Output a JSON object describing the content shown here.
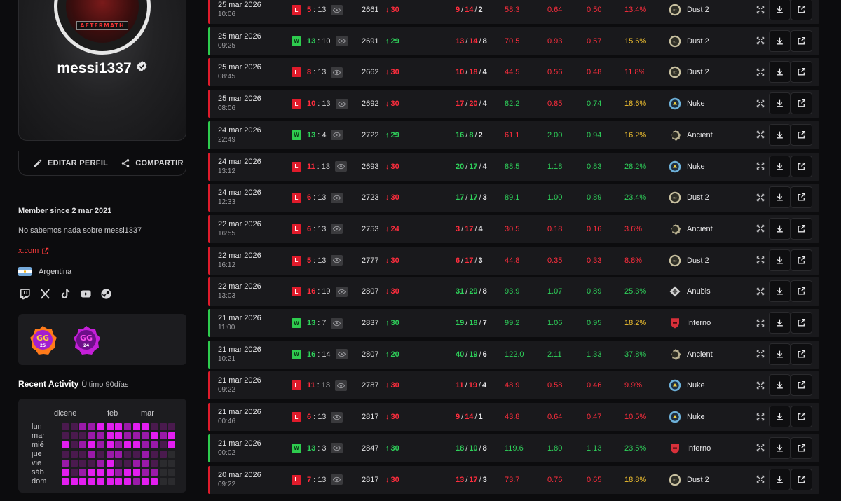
{
  "profile": {
    "username": "messi1337",
    "avatar_text": "AFTERMATH",
    "edit_label": "EDITAR PERFIL",
    "share_label": "COMPARTIR",
    "member_since": "Member since 2 mar 2021",
    "bio": "No sabemos nada sobre messi1337",
    "link": "x.com",
    "country": "Argentina",
    "socials": [
      "twitch-icon",
      "x-icon",
      "tiktok-icon",
      "youtube-icon",
      "steam-icon"
    ],
    "badges": [
      {
        "label": "GG",
        "year": "25"
      },
      {
        "label": "GG",
        "year": "24"
      }
    ]
  },
  "activity": {
    "title": "Recent Activity",
    "subtitle": "Último 90días",
    "months": [
      "dicene",
      "feb",
      "mar"
    ],
    "days": [
      "lun",
      "mar",
      "mié",
      "jue",
      "vie",
      "sáb",
      "dom"
    ],
    "levels": [
      [
        1,
        1,
        2,
        2,
        3,
        3,
        3,
        2,
        3,
        3,
        1,
        1,
        1
      ],
      [
        1,
        1,
        1,
        2,
        2,
        3,
        3,
        2,
        2,
        2,
        3,
        2,
        3
      ],
      [
        3,
        1,
        2,
        3,
        2,
        3,
        2,
        3,
        3,
        2,
        2,
        1,
        3
      ],
      [
        1,
        1,
        1,
        2,
        1,
        2,
        2,
        1,
        1,
        2,
        1,
        1,
        0
      ],
      [
        2,
        1,
        1,
        1,
        2,
        3,
        1,
        1,
        2,
        2,
        1,
        0,
        0
      ],
      [
        3,
        1,
        2,
        3,
        3,
        3,
        2,
        3,
        3,
        2,
        2,
        0,
        0
      ],
      [
        3,
        3,
        3,
        3,
        3,
        3,
        3,
        3,
        2,
        3,
        3,
        0,
        0
      ]
    ],
    "colors": [
      "#2b2b2e",
      "#4a1a4e",
      "#9a1aa8",
      "#e31ef0"
    ]
  },
  "colors": {
    "loss": "#e01b2b",
    "win": "#2ecc4e",
    "accent": "#ff3b3b"
  },
  "matches": [
    {
      "date": "25 mar 2026",
      "time": "10:06",
      "result": "L",
      "s1": "5",
      "s2": "13",
      "elo": "2661",
      "delta": "30",
      "dir": "down",
      "k": "9",
      "a": "14",
      "d": "2",
      "adr": "58.3",
      "kd": "0.64",
      "kr": "0.50",
      "hs": "13.4%",
      "map": "Dust 2"
    },
    {
      "date": "25 mar 2026",
      "time": "09:25",
      "result": "W",
      "s1": "13",
      "s2": "10",
      "elo": "2691",
      "delta": "29",
      "dir": "up",
      "k": "13",
      "a": "14",
      "d": "8",
      "adr": "70.5",
      "kd": "0.93",
      "kr": "0.57",
      "hs": "15.6%",
      "map": "Dust 2"
    },
    {
      "date": "25 mar 2026",
      "time": "08:45",
      "result": "L",
      "s1": "8",
      "s2": "13",
      "elo": "2662",
      "delta": "30",
      "dir": "down",
      "k": "10",
      "a": "18",
      "d": "4",
      "adr": "44.5",
      "kd": "0.56",
      "kr": "0.48",
      "hs": "11.8%",
      "map": "Dust 2"
    },
    {
      "date": "25 mar 2026",
      "time": "08:06",
      "result": "L",
      "s1": "10",
      "s2": "13",
      "elo": "2692",
      "delta": "30",
      "dir": "down",
      "k": "17",
      "a": "20",
      "d": "4",
      "adr": "82.2",
      "kd": "0.85",
      "kr": "0.74",
      "hs": "18.6%",
      "map": "Nuke"
    },
    {
      "date": "24 mar 2026",
      "time": "22:49",
      "result": "W",
      "s1": "13",
      "s2": "4",
      "elo": "2722",
      "delta": "29",
      "dir": "up",
      "k": "16",
      "a": "8",
      "d": "2",
      "adr": "61.1",
      "kd": "2.00",
      "kr": "0.94",
      "hs": "16.2%",
      "map": "Ancient"
    },
    {
      "date": "24 mar 2026",
      "time": "13:12",
      "result": "L",
      "s1": "11",
      "s2": "13",
      "elo": "2693",
      "delta": "30",
      "dir": "down",
      "k": "20",
      "a": "17",
      "d": "4",
      "adr": "88.5",
      "kd": "1.18",
      "kr": "0.83",
      "hs": "28.2%",
      "map": "Nuke"
    },
    {
      "date": "24 mar 2026",
      "time": "12:33",
      "result": "L",
      "s1": "6",
      "s2": "13",
      "elo": "2723",
      "delta": "30",
      "dir": "down",
      "k": "17",
      "a": "17",
      "d": "3",
      "adr": "89.1",
      "kd": "1.00",
      "kr": "0.89",
      "hs": "23.4%",
      "map": "Dust 2"
    },
    {
      "date": "22 mar 2026",
      "time": "16:55",
      "result": "L",
      "s1": "6",
      "s2": "13",
      "elo": "2753",
      "delta": "24",
      "dir": "down",
      "k": "3",
      "a": "17",
      "d": "4",
      "adr": "30.5",
      "kd": "0.18",
      "kr": "0.16",
      "hs": "3.6%",
      "map": "Ancient"
    },
    {
      "date": "22 mar 2026",
      "time": "16:12",
      "result": "L",
      "s1": "5",
      "s2": "13",
      "elo": "2777",
      "delta": "30",
      "dir": "down",
      "k": "6",
      "a": "17",
      "d": "3",
      "adr": "44.8",
      "kd": "0.35",
      "kr": "0.33",
      "hs": "8.8%",
      "map": "Dust 2"
    },
    {
      "date": "22 mar 2026",
      "time": "13:03",
      "result": "L",
      "s1": "16",
      "s2": "19",
      "elo": "2807",
      "delta": "30",
      "dir": "down",
      "k": "31",
      "a": "29",
      "d": "8",
      "adr": "93.9",
      "kd": "1.07",
      "kr": "0.89",
      "hs": "25.3%",
      "map": "Anubis"
    },
    {
      "date": "21 mar 2026",
      "time": "11:00",
      "result": "W",
      "s1": "13",
      "s2": "7",
      "elo": "2837",
      "delta": "30",
      "dir": "up",
      "k": "19",
      "a": "18",
      "d": "7",
      "adr": "99.2",
      "kd": "1.06",
      "kr": "0.95",
      "hs": "18.2%",
      "map": "Inferno"
    },
    {
      "date": "21 mar 2026",
      "time": "10:21",
      "result": "W",
      "s1": "16",
      "s2": "14",
      "elo": "2807",
      "delta": "20",
      "dir": "up",
      "k": "40",
      "a": "19",
      "d": "6",
      "adr": "122.0",
      "kd": "2.11",
      "kr": "1.33",
      "hs": "37.8%",
      "map": "Ancient"
    },
    {
      "date": "21 mar 2026",
      "time": "09:22",
      "result": "L",
      "s1": "11",
      "s2": "13",
      "elo": "2787",
      "delta": "30",
      "dir": "down",
      "k": "11",
      "a": "19",
      "d": "4",
      "adr": "48.9",
      "kd": "0.58",
      "kr": "0.46",
      "hs": "9.9%",
      "map": "Nuke"
    },
    {
      "date": "21 mar 2026",
      "time": "00:46",
      "result": "L",
      "s1": "6",
      "s2": "13",
      "elo": "2817",
      "delta": "30",
      "dir": "down",
      "k": "9",
      "a": "14",
      "d": "1",
      "adr": "43.8",
      "kd": "0.64",
      "kr": "0.47",
      "hs": "10.5%",
      "map": "Nuke"
    },
    {
      "date": "21 mar 2026",
      "time": "00:02",
      "result": "W",
      "s1": "13",
      "s2": "3",
      "elo": "2847",
      "delta": "30",
      "dir": "up",
      "k": "18",
      "a": "10",
      "d": "8",
      "adr": "119.6",
      "kd": "1.80",
      "kr": "1.13",
      "hs": "23.5%",
      "map": "Inferno"
    },
    {
      "date": "20 mar 2026",
      "time": "09:22",
      "result": "L",
      "s1": "7",
      "s2": "13",
      "elo": "2817",
      "delta": "30",
      "dir": "down",
      "k": "13",
      "a": "17",
      "d": "3",
      "adr": "73.7",
      "kd": "0.76",
      "kr": "0.65",
      "hs": "18.8%",
      "map": "Dust 2"
    }
  ]
}
